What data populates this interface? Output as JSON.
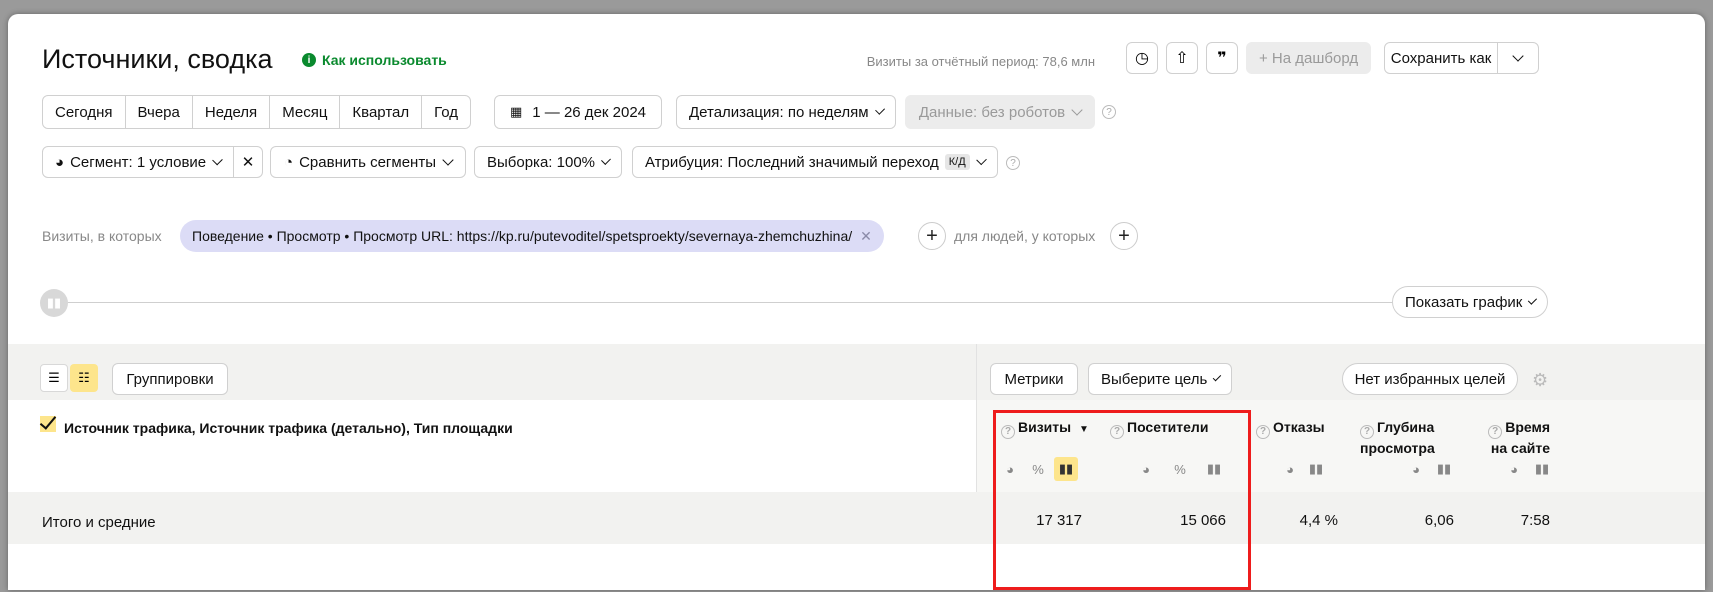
{
  "header": {
    "title": "Источники, сводка",
    "howto": "Как использовать",
    "visits_period": "Визиты за отчётный период: 78,6 млн",
    "to_dashboard": "+ На дашборд",
    "save_as": "Сохранить как"
  },
  "period": {
    "items": [
      "Сегодня",
      "Вчера",
      "Неделя",
      "Месяц",
      "Квартал",
      "Год"
    ],
    "date_range": "1 — 26 дек 2024",
    "detail": "Детализация: по неделям",
    "data": "Данные: без роботов"
  },
  "segment": {
    "segment": "Сегмент: 1 условие",
    "compare": "Сравнить сегменты",
    "sample": "Выборка: 100%",
    "attribution": "Атрибуция: Последний значимый переход",
    "attribution_badge": "К/Д"
  },
  "filter": {
    "prefix": "Визиты, в которых",
    "condition": "Поведение • Просмотр • Просмотр URL: https://kp.ru/putevoditel/spetsproekty/severnaya-zhemchuzhina/",
    "people": "для людей, у которых"
  },
  "graph": {
    "show_graph": "Показать график"
  },
  "toolbar": {
    "groupings": "Группировки",
    "metrics": "Метрики",
    "goal": "Выберите цель",
    "no_goals": "Нет избранных целей"
  },
  "table": {
    "dimension": "Источник трафика, Источник трафика (детально), Тип площадки",
    "columns": {
      "visits": "Визиты",
      "visitors": "Посетители",
      "bounce": "Отказы",
      "depth_1": "Глубина",
      "depth_2": "просмотра",
      "time_1": "Время",
      "time_2": "на сайте"
    },
    "total_label": "Итого и средние",
    "totals": {
      "visits": "17 317",
      "visitors": "15 066",
      "bounce": "4,4 %",
      "depth": "6,06",
      "time": "7:58"
    }
  },
  "colors": {
    "accent_yellow": "#fde58c",
    "pill_lavender": "#dcdcf6",
    "highlight_red": "#ee1c1c",
    "link_green": "#0a8a2e"
  }
}
